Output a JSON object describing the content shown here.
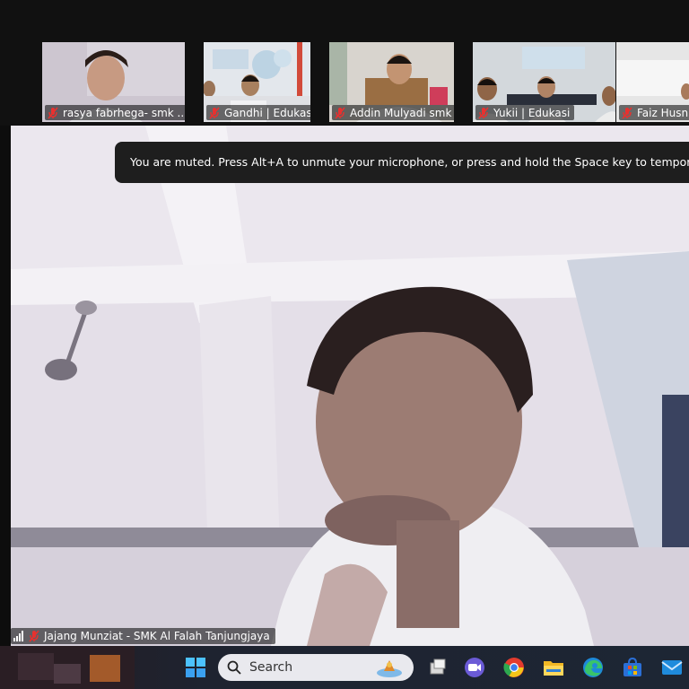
{
  "participants": [
    {
      "name": "rasya fabrhega- smk ...",
      "muted": true
    },
    {
      "name": "Gandhi | Edukasi",
      "muted": true
    },
    {
      "name": "Addin Mulyadi smk al...",
      "muted": true
    },
    {
      "name": "Yukii | Edukasi",
      "muted": true
    },
    {
      "name": "Faiz Husni",
      "muted": true
    }
  ],
  "toast": {
    "message": "You are muted. Press Alt+A to unmute your microphone, or press and hold the Space key to temporarily unmute"
  },
  "main_video": {
    "name": "Jajang Munziat - SMK Al Falah Tanjungjaya",
    "muted": true
  },
  "taskbar": {
    "search_label": "Search",
    "apps": [
      "start-icon",
      "task-view-icon",
      "zoom-icon",
      "chrome-icon",
      "file-explorer-icon",
      "edge-icon",
      "store-icon",
      "mail-icon"
    ]
  },
  "colors": {
    "mute_red": "#e8312f",
    "toast_bg": "#1e1e1e"
  }
}
